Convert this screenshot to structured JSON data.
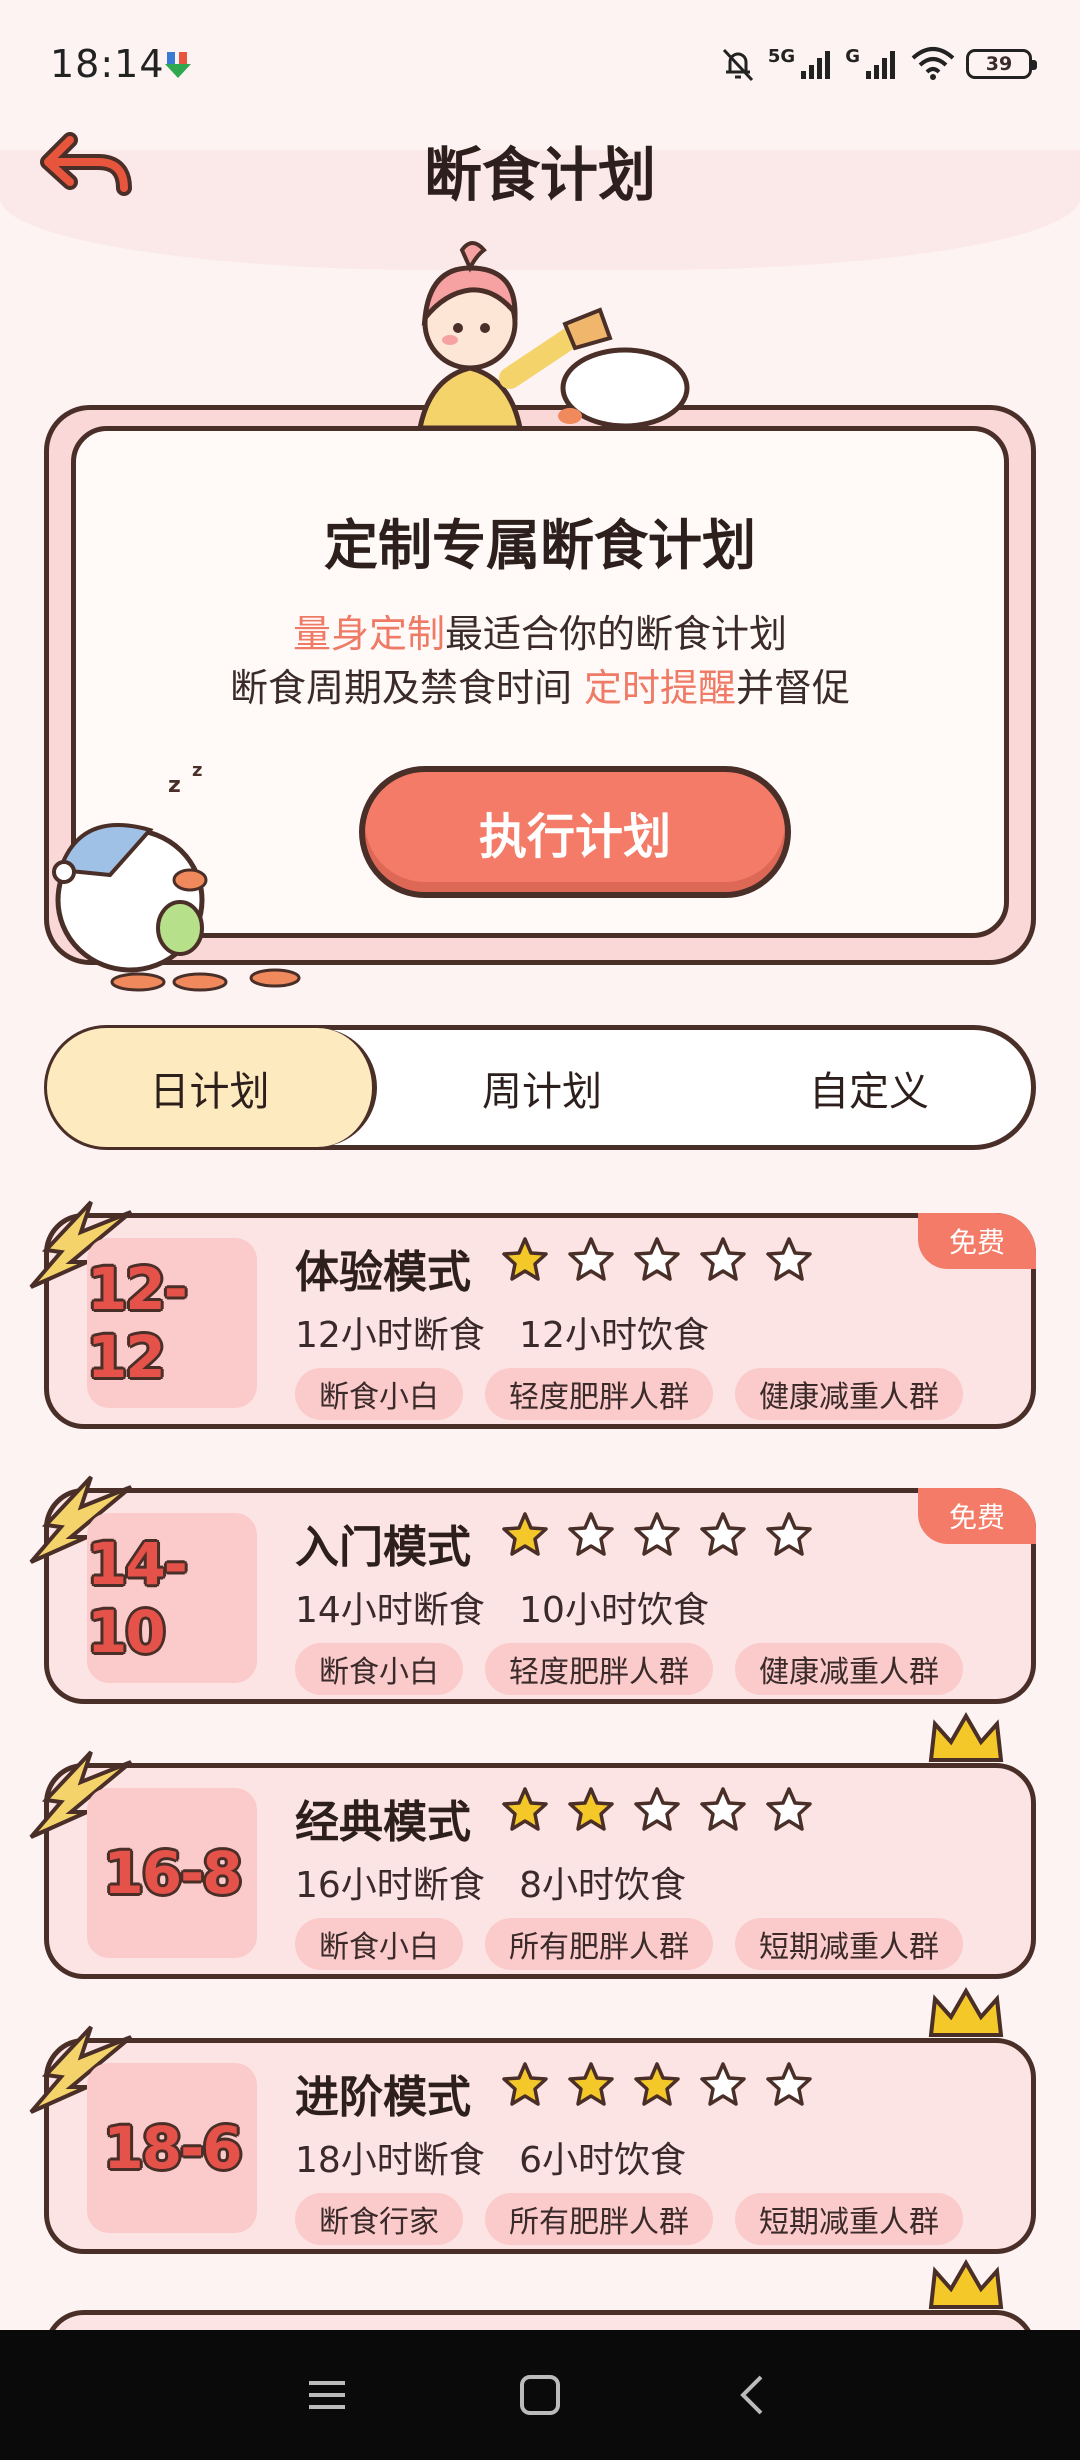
{
  "status_bar": {
    "time": "18:14",
    "network_1": "5G",
    "network_2": "G",
    "battery": "39"
  },
  "header": {
    "title": "断食计划",
    "back_icon": "back-arrow-icon"
  },
  "hero": {
    "title": "定制专属断食计划",
    "line1_highlight": "量身定制",
    "line1_rest": "最适合你的断食计划",
    "line2_start": "断食周期及禁食时间 ",
    "line2_highlight": "定时提醒",
    "line2_end": "并督促",
    "button_label": "执行计划"
  },
  "tabs": [
    "日计划",
    "周计划",
    "自定义"
  ],
  "plans": [
    {
      "ratio": "12-12",
      "title": "体验模式",
      "stars": 1,
      "desc": "12小时断食   12小时饮食",
      "tags": [
        "断食小白",
        "轻度肥胖人群",
        "健康减重人群"
      ],
      "badge": "免费"
    },
    {
      "ratio": "14-10",
      "title": "入门模式",
      "stars": 1,
      "desc": "14小时断食   10小时饮食",
      "tags": [
        "断食小白",
        "轻度肥胖人群",
        "健康减重人群"
      ],
      "badge": "免费"
    },
    {
      "ratio": "16-8",
      "title": "经典模式",
      "stars": 2,
      "desc": "16小时断食   8小时饮食",
      "tags": [
        "断食小白",
        "所有肥胖人群",
        "短期减重人群"
      ],
      "badge": ""
    },
    {
      "ratio": "18-6",
      "title": "进阶模式",
      "stars": 3,
      "desc": "18小时断食   6小时饮食",
      "tags": [
        "断食行家",
        "所有肥胖人群",
        "短期减重人群"
      ],
      "badge": ""
    }
  ],
  "colors": {
    "accent": "#f37b67",
    "outline": "#4a2e28",
    "card_bg": "#fce4e4",
    "tag_bg": "#fbcaca",
    "star": "#f5c82a"
  }
}
